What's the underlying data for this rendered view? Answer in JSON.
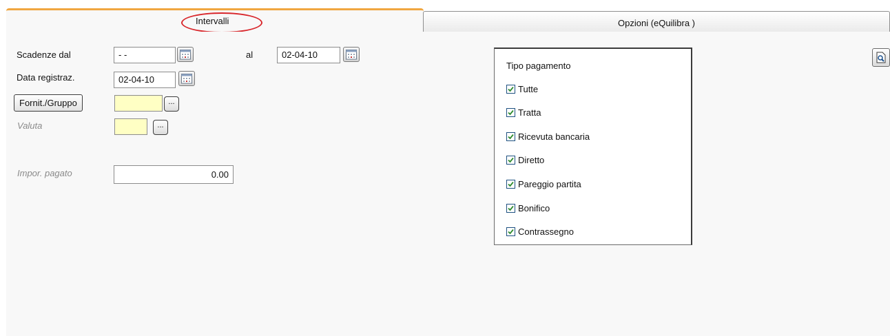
{
  "tabs": {
    "active_label": "Intervalli",
    "inactive_label": "Opzioni (eQuilibra )"
  },
  "form": {
    "scadenze_label": "Scadenze dal",
    "scadenze_from_value": "- -",
    "al_label": "al",
    "scadenze_to_value": "02-04-10",
    "data_registraz_label": "Data registraz.",
    "data_registraz_value": "02-04-10",
    "fornit_button_label": "Fornit./Gruppo",
    "fornit_value": "",
    "dots_label": "...",
    "valuta_label": "Valuta",
    "valuta_value": "",
    "impor_pagato_label": "Impor. pagato",
    "impor_pagato_value": "0.00"
  },
  "tipo_pagamento": {
    "title": "Tipo pagamento",
    "options": [
      {
        "label": "Tutte",
        "checked": true
      },
      {
        "label": "Tratta",
        "checked": true
      },
      {
        "label": "Ricevuta bancaria",
        "checked": true
      },
      {
        "label": "Diretto",
        "checked": true
      },
      {
        "label": "Pareggio partita",
        "checked": true
      },
      {
        "label": "Bonifico",
        "checked": true
      },
      {
        "label": "Contrassegno",
        "checked": true
      }
    ]
  },
  "colors": {
    "active_tab_accent": "#f0a640",
    "annotation_oval": "#d8262b",
    "lookup_field_bg": "#ffffc4",
    "checkbox_check": "#2e8b2e"
  },
  "icons": {
    "calendar": "calendar-icon",
    "tool": "print-preview-icon"
  }
}
